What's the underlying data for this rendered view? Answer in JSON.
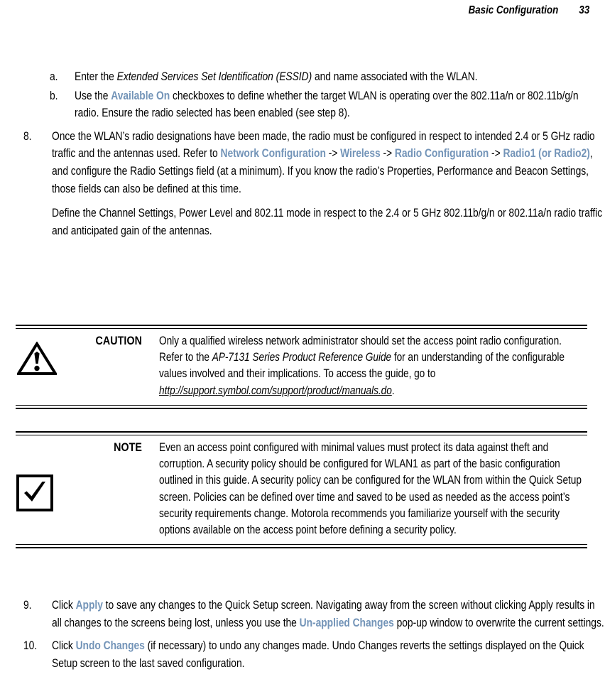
{
  "header": {
    "title": "Basic Configuration",
    "page_number": "33"
  },
  "accent_color": "#7394B8",
  "sub_items": [
    {
      "marker": "a.",
      "segments": [
        {
          "text": "Enter the ",
          "style": "normal"
        },
        {
          "text": "Extended Services Set Identification (ESSID)",
          "style": "italic"
        },
        {
          "text": " and name associated with the WLAN.",
          "style": "normal"
        }
      ]
    },
    {
      "marker": "b.",
      "segments": [
        {
          "text": "Use the ",
          "style": "normal"
        },
        {
          "text": "Available On",
          "style": "ui"
        },
        {
          "text": " checkboxes to define whether the target WLAN is operating over the 802.11a/n or 802.11b/g/n radio. Ensure the radio selected has been enabled (see step 8).",
          "style": "normal"
        }
      ]
    }
  ],
  "step_8": {
    "marker": "8.",
    "segments": [
      {
        "text": "Once the WLAN’s radio designations have been made, the radio must be configured in respect to intended 2.4 or 5 GHz radio traffic and the antennas used. Refer to ",
        "style": "normal"
      },
      {
        "text": "Network Configuration",
        "style": "ui"
      },
      {
        "text": " -> ",
        "style": "arrow"
      },
      {
        "text": "Wireless",
        "style": "ui"
      },
      {
        "text": " -> ",
        "style": "arrow"
      },
      {
        "text": "Radio Configuration",
        "style": "ui"
      },
      {
        "text": " -> ",
        "style": "arrow"
      },
      {
        "text": "Radio1 (or Radio2)",
        "style": "ui"
      },
      {
        "text": ", and configure the Radio Settings field (at a minimum). If you know the radio’s Properties, Performance and Beacon Settings, those fields can also be defined at this time.",
        "style": "normal"
      }
    ]
  },
  "step_8_paragraph": "Define the Channel Settings, Power Level and 802.11 mode in respect to the 2.4 or 5 GHz 802.11b/g/n or 802.11a/n radio traffic and anticipated gain of the antennas.",
  "caution": {
    "icon": "warning-triangle-icon",
    "label": "CAUTION",
    "segments": [
      {
        "text": "Only a qualified wireless network administrator should set the access point radio configuration. Refer to the ",
        "style": "normal"
      },
      {
        "text": "AP-7131 Series Product Reference Guide",
        "style": "italic"
      },
      {
        "text": " for an understanding of the configurable values involved and their implications. To access the guide, go to ",
        "style": "normal"
      },
      {
        "text": "http://support.symbol.com/support/product/manuals.do",
        "style": "url"
      },
      {
        "text": ".",
        "style": "normal"
      }
    ]
  },
  "note": {
    "icon": "checkmark-box-icon",
    "label": "NOTE",
    "segments": [
      {
        "text": "Even an access point configured with minimal values must protect its data against theft and corruption. A security policy should be configured for WLAN1 as part of the basic configuration outlined in this guide. A security policy can be configured for the WLAN from within the Quick Setup screen. Policies can be defined over time and saved to be used as needed as the access point’s security requirements change. Motorola recommends you familiarize yourself with the security options available on the access point before defining a security policy.",
        "style": "normal"
      }
    ]
  },
  "step_9": {
    "marker": "9.",
    "segments": [
      {
        "text": "Click ",
        "style": "normal"
      },
      {
        "text": "Apply",
        "style": "ui"
      },
      {
        "text": " to save any changes to the Quick Setup screen. Navigating away from the screen without clicking Apply results in all changes to the screens being lost, unless you use the ",
        "style": "normal"
      },
      {
        "text": "Un-applied Changes",
        "style": "ui"
      },
      {
        "text": " pop-up window to overwrite the current settings.",
        "style": "normal"
      }
    ]
  },
  "step_10": {
    "marker": "10.",
    "segments": [
      {
        "text": "Click ",
        "style": "normal"
      },
      {
        "text": "Undo Changes",
        "style": "ui"
      },
      {
        "text": " (if necessary) to undo any changes made. Undo Changes reverts the settings displayed on the Quick Setup screen to the last saved configuration.",
        "style": "normal"
      }
    ]
  }
}
